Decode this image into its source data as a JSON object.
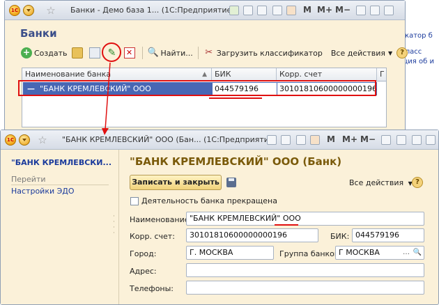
{
  "background": {
    "right_text": [
      "фикатор б",
      "й класс",
      "рация об и"
    ]
  },
  "window1": {
    "title": "Банки - Демо база 1... (1С:Предприятие)",
    "toolbar_right": [
      "M",
      "M+",
      "M−"
    ],
    "form_title": "Банки",
    "commands": {
      "create": "Создать",
      "find": "Найти...",
      "load_classifier": "Загрузить классификатор",
      "all_actions": "Все действия",
      "help": "?"
    },
    "table": {
      "columns": [
        "Наименование банка",
        "БИК",
        "Корр. счет",
        "Г"
      ],
      "rows": [
        {
          "name": "\"БАНК КРЕМЛЕВСКИЙ\" ООО",
          "bik": "044579196",
          "corr": "30101810600000000196"
        }
      ]
    }
  },
  "window2": {
    "title": "\"БАНК КРЕМЛЕВСКИЙ\" ООО (Бан... (1С:Предприятие)",
    "toolbar_right": [
      "M",
      "M+",
      "M−"
    ],
    "nav": {
      "title": "\"БАНК КРЕМЛЕВСКИ...",
      "section": "Перейти",
      "links": [
        "Настройки ЭДО"
      ]
    },
    "form_title": "\"БАНК КРЕМЛЕВСКИЙ\" ООО (Банк)",
    "save_close": "Записать и закрыть",
    "all_actions": "Все действия",
    "help": "?",
    "checkbox_label": "Деятельность банка прекращена",
    "fields": {
      "name_label": "Наименование:",
      "name_value": "\"БАНК КРЕМЛЕВСКИЙ\" ООО",
      "corr_label": "Корр. счет:",
      "corr_value": "30101810600000000196",
      "bik_label": "БИК:",
      "bik_value": "044579196",
      "city_label": "Город:",
      "city_value": "Г. МОСКВА",
      "group_label": "Группа банков:",
      "group_value": "Г МОСКВА",
      "address_label": "Адрес:",
      "address_value": "",
      "phones_label": "Телефоны:",
      "phones_value": ""
    }
  },
  "colors": {
    "form_bg": "#fbf1d9",
    "selection": "#4867b4",
    "annotation_red": "#e01010",
    "link_blue": "#1a3a9c"
  }
}
